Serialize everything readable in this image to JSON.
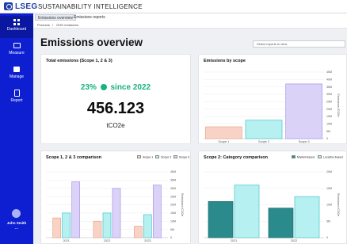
{
  "app": {
    "brand": "LSEG",
    "title": "SUSTAINABILITY INTELLIGENCE"
  },
  "sidebar": {
    "items": [
      {
        "label": "Dashboard",
        "icon": "dashboard-icon"
      },
      {
        "label": "Measure",
        "icon": "monitor-icon"
      },
      {
        "label": "Manage",
        "icon": "image-icon"
      },
      {
        "label": "Report",
        "icon": "document-icon"
      }
    ],
    "user": {
      "name": "John Smith",
      "more": "..."
    }
  },
  "tabs": [
    "Emissions overview",
    "Emissions reports"
  ],
  "breadcrumb": [
    "Products",
    "/",
    "GHG emissions"
  ],
  "page": {
    "title": "Emissions overview",
    "select_placeholder": "Select reports to view"
  },
  "total_card": {
    "title": "Total emissions (Scope 1, 2 & 3)",
    "change": "23%",
    "change_suffix": "since 2022",
    "value": "456.123",
    "unit": "tCO2e"
  },
  "colors": {
    "accent": "#0d1fd1",
    "positive": "#17b37a",
    "scope1": "#f8d3c5",
    "scope2": "#b7f0f1",
    "scope3": "#dbd2f7"
  },
  "chart_data": [
    {
      "type": "bar",
      "title": "Emissions by scope",
      "categories": [
        "Scope 1",
        "Scope 2",
        "Scope 3"
      ],
      "values": [
        8,
        12.5,
        37
      ],
      "ylabel": "Emissions tCO2e",
      "yticks": [
        "0",
        "5M",
        "10M",
        "15M",
        "20M",
        "25M",
        "30M",
        "35M",
        "40M",
        "45M"
      ],
      "ylim": [
        0,
        45
      ],
      "colors": [
        "#f8d3c5",
        "#b7f0f1",
        "#dbd2f7"
      ]
    },
    {
      "type": "bar",
      "title": "Scope 1, 2 & 3 comparison",
      "categories": [
        "2021",
        "2022",
        "2023"
      ],
      "series": [
        {
          "name": "Scope 1",
          "values": [
            12,
            10,
            7
          ]
        },
        {
          "name": "Scope 2",
          "values": [
            15,
            15,
            14
          ]
        },
        {
          "name": "Scope 3",
          "values": [
            34,
            30,
            32
          ]
        }
      ],
      "ylabel": "Emissions tCO2e",
      "yticks": [
        "0",
        "5M",
        "10M",
        "15M",
        "20M",
        "25M",
        "30M",
        "35M",
        "40M"
      ],
      "ylim": [
        0,
        40
      ],
      "colors": [
        "#f8d3c5",
        "#b7f0f1",
        "#dbd2f7"
      ]
    },
    {
      "type": "bar",
      "title": "Scope 2: Category comparison",
      "categories": [
        "2021",
        "2022"
      ],
      "series": [
        {
          "name": "Market-based",
          "values": [
            11,
            9
          ]
        },
        {
          "name": "Location-based",
          "values": [
            16,
            12.5
          ]
        }
      ],
      "ylabel": "Emissions tCO2e",
      "yticks": [
        "0",
        "5M",
        "10M",
        "15M",
        "20M"
      ],
      "ylim": [
        0,
        20
      ],
      "colors": [
        "#2a8a8c",
        "#b7f0f1"
      ]
    }
  ]
}
